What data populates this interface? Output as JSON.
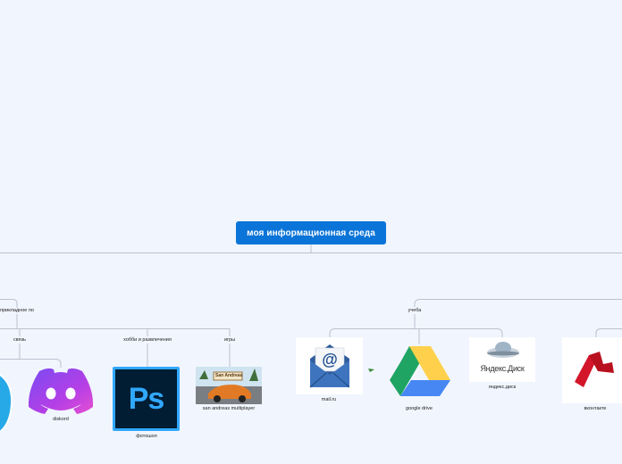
{
  "root": {
    "label": "моя информационная среда"
  },
  "branches": {
    "left": "прикладное по",
    "right": "учеба"
  },
  "subbranches": {
    "svyaz": "связь",
    "hobby": "хобби и развлечения",
    "games": "игры"
  },
  "items": {
    "diskord": "diskord",
    "photoshop": "фотошоп",
    "samp": "san andreas multiplayer",
    "mailru": "mail.ru",
    "gdrive": "google drive",
    "ydisk": "яндекс.диск",
    "vk": "вконтакте"
  },
  "logos": {
    "photoshop_text": "Ps",
    "ydisk_text": "Яндекс.Диск",
    "samp_text": "San Andreas"
  },
  "colors": {
    "root_bg": "#0b74d8",
    "line": "#b9c3cf",
    "discord": "#9b3ce8",
    "photoshop_bg": "#001d34",
    "photoshop_accent": "#31a8ff"
  }
}
